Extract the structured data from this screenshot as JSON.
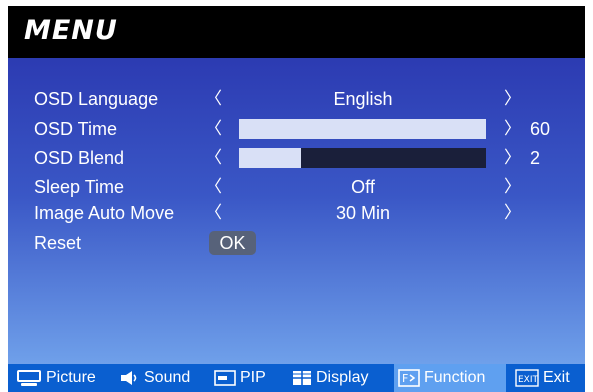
{
  "menu": {
    "title": "MENU",
    "items": [
      {
        "label": "OSD Language",
        "value": "English"
      },
      {
        "label": "OSD Time",
        "value": "60",
        "level": 1.0
      },
      {
        "label": "OSD Blend",
        "value": "2",
        "level": 0.25
      },
      {
        "label": "Sleep Time",
        "value": "Off"
      },
      {
        "label": "Image Auto Move",
        "value": "30 Min"
      },
      {
        "label": "Reset",
        "button": "OK"
      }
    ],
    "arrow_left": "〈",
    "arrow_right": "〉"
  },
  "tabs": [
    {
      "label": "Picture",
      "icon": "monitor-icon"
    },
    {
      "label": "Sound",
      "icon": "speaker-icon"
    },
    {
      "label": "PIP",
      "icon": "pip-icon"
    },
    {
      "label": "Display",
      "icon": "display-grid-icon"
    },
    {
      "label": "Function",
      "icon": "function-icon",
      "active": true
    },
    {
      "label": "Exit",
      "icon": "exit-icon"
    }
  ],
  "colors": {
    "accent_active_tab": "#5fa0f0",
    "footer": "#0a5fd0",
    "panel_top": "#2c3bb2",
    "panel_bottom": "#6fa0ea"
  }
}
